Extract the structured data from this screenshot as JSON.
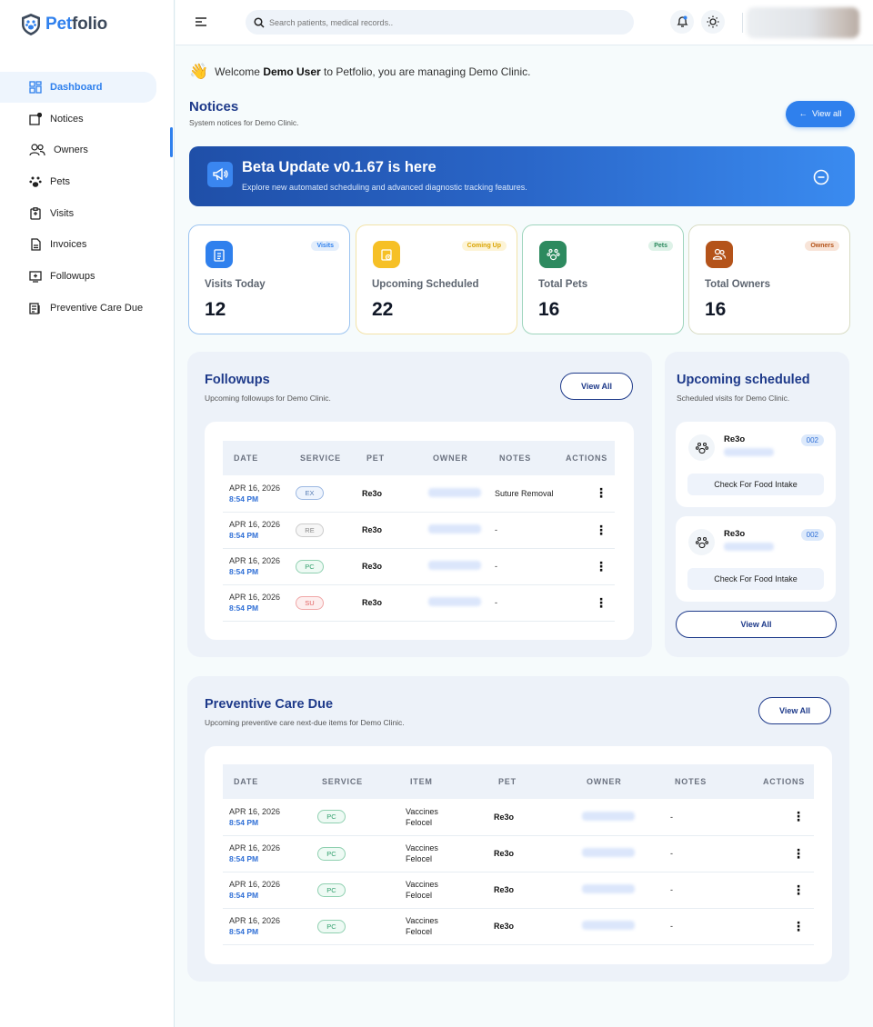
{
  "brand": {
    "name_prefix": "Pet",
    "name_suffix": "folio"
  },
  "sidebar": {
    "items": [
      {
        "label": "Dashboard",
        "icon": "grid-icon",
        "active": true
      },
      {
        "label": "Notices",
        "icon": "notice-icon"
      },
      {
        "label": "Owners",
        "icon": "users-icon"
      },
      {
        "label": "Pets",
        "icon": "paw-icon"
      },
      {
        "label": "Visits",
        "icon": "clipboard-icon"
      },
      {
        "label": "Invoices",
        "icon": "invoice-icon"
      },
      {
        "label": "Followups",
        "icon": "followup-icon"
      },
      {
        "label": "Preventive Care Due",
        "icon": "care-icon"
      }
    ]
  },
  "topbar": {
    "search_placeholder": "Search patients, medical records.."
  },
  "welcome": {
    "pre": "Welcome",
    "user": "Demo User",
    "post": "to Petfolio, you are managing Demo Clinic."
  },
  "notices": {
    "title": "Notices",
    "subtitle": "System notices for Demo Clinic.",
    "view_all": "View all"
  },
  "banner": {
    "title": "Beta Update v0.1.67 is here",
    "subtitle": "Explore new automated scheduling and advanced diagnostic tracking features."
  },
  "stats": [
    {
      "label": "Visits Today",
      "value": "12",
      "badge": "Visits",
      "color": "#2f80ed"
    },
    {
      "label": "Upcoming Scheduled",
      "value": "22",
      "badge": "Coming Up",
      "color": "#f6c026"
    },
    {
      "label": "Total Pets",
      "value": "16",
      "badge": "Pets",
      "color": "#2d8a5f"
    },
    {
      "label": "Total Owners",
      "value": "16",
      "badge": "Owners",
      "color": "#b4531a"
    }
  ],
  "followups": {
    "title": "Followups",
    "subtitle": "Upcoming followups for Demo Clinic.",
    "view_all": "View All",
    "columns": [
      "DATE",
      "SERVICE",
      "PET",
      "OWNER",
      "NOTES",
      "ACTIONS"
    ],
    "rows": [
      {
        "date": "APR 16, 2026",
        "time": "8:54 PM",
        "service": "EX",
        "pet": "Re3o",
        "notes": "Suture Removal"
      },
      {
        "date": "APR 16, 2026",
        "time": "8:54 PM",
        "service": "RE",
        "pet": "Re3o",
        "notes": "-"
      },
      {
        "date": "APR 16, 2026",
        "time": "8:54 PM",
        "service": "PC",
        "pet": "Re3o",
        "notes": "-"
      },
      {
        "date": "APR 16, 2026",
        "time": "8:54 PM",
        "service": "SU",
        "pet": "Re3o",
        "notes": "-"
      }
    ]
  },
  "upcoming": {
    "title": "Upcoming scheduled",
    "subtitle": "Scheduled visits for Demo Clinic.",
    "view_all": "View All",
    "cards": [
      {
        "pet": "Re3o",
        "number": "002",
        "action": "Check For Food Intake"
      },
      {
        "pet": "Re3o",
        "number": "002",
        "action": "Check For Food Intake"
      }
    ]
  },
  "preventive": {
    "title": "Preventive Care Due",
    "subtitle": "Upcoming preventive care next-due items for Demo Clinic.",
    "view_all": "View All",
    "columns": [
      "DATE",
      "SERVICE",
      "ITEM",
      "PET",
      "OWNER",
      "NOTES",
      "ACTIONS"
    ],
    "rows": [
      {
        "date": "APR 16, 2026",
        "time": "8:54 PM",
        "service": "PC",
        "item1": "Vaccines",
        "item2": "Felocel",
        "pet": "Re3o",
        "notes": "-"
      },
      {
        "date": "APR 16, 2026",
        "time": "8:54 PM",
        "service": "PC",
        "item1": "Vaccines",
        "item2": "Felocel",
        "pet": "Re3o",
        "notes": "-"
      },
      {
        "date": "APR 16, 2026",
        "time": "8:54 PM",
        "service": "PC",
        "item1": "Vaccines",
        "item2": "Felocel",
        "pet": "Re3o",
        "notes": "-"
      },
      {
        "date": "APR 16, 2026",
        "time": "8:54 PM",
        "service": "PC",
        "item1": "Vaccines",
        "item2": "Felocel",
        "pet": "Re3o",
        "notes": "-"
      }
    ]
  }
}
